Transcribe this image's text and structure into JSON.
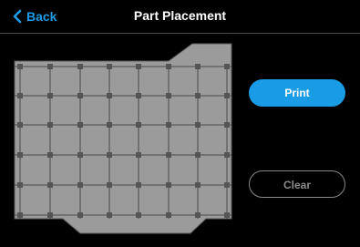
{
  "header": {
    "back_label": "Back",
    "title": "Part Placement"
  },
  "actions": {
    "print_label": "Print",
    "clear_label": "Clear"
  },
  "colors": {
    "accent": "#1a9be6",
    "bed_fill": "#9b9b9b",
    "grid_line": "#4a4a4a",
    "disabled": "#8a8a8a"
  },
  "icons": {
    "back": "chevron-left-icon"
  }
}
